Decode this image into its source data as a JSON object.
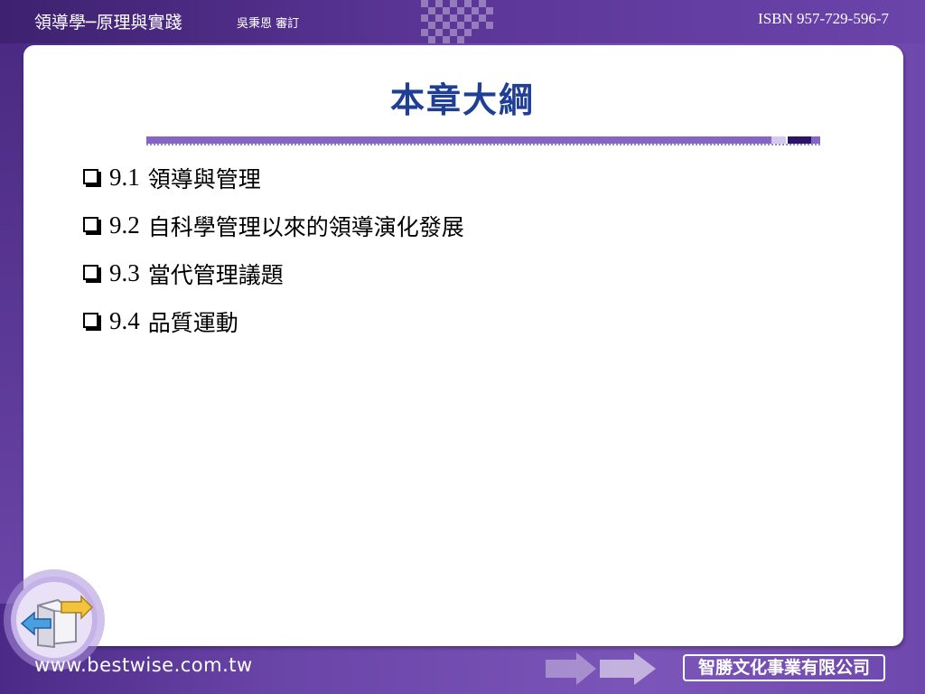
{
  "header": {
    "book_title": "領導學─原理與實踐",
    "reviewer": "吳秉恩 審訂",
    "isbn": "ISBN 957-729-596-7"
  },
  "slide": {
    "title": "本章大綱",
    "outline": [
      {
        "number": "9.1",
        "text": "領導與管理"
      },
      {
        "number": "9.2",
        "text": "自科學管理以來的領導演化發展"
      },
      {
        "number": "9.3",
        "text": "當代管理議題"
      },
      {
        "number": "9.4",
        "text": "品質運動"
      }
    ]
  },
  "footer": {
    "website": "www.bestwise.com.tw",
    "publisher": "智勝文化事業有限公司"
  },
  "icons": {
    "back_button": "arrow-left-icon",
    "bullet": "checkbox-icon",
    "decor_arrows": "double-arrow-right-icon"
  },
  "colors": {
    "background": "#6a45a8",
    "title": "#1f3f95",
    "rule": "#8566c4",
    "rule_dark": "#2b1466"
  }
}
